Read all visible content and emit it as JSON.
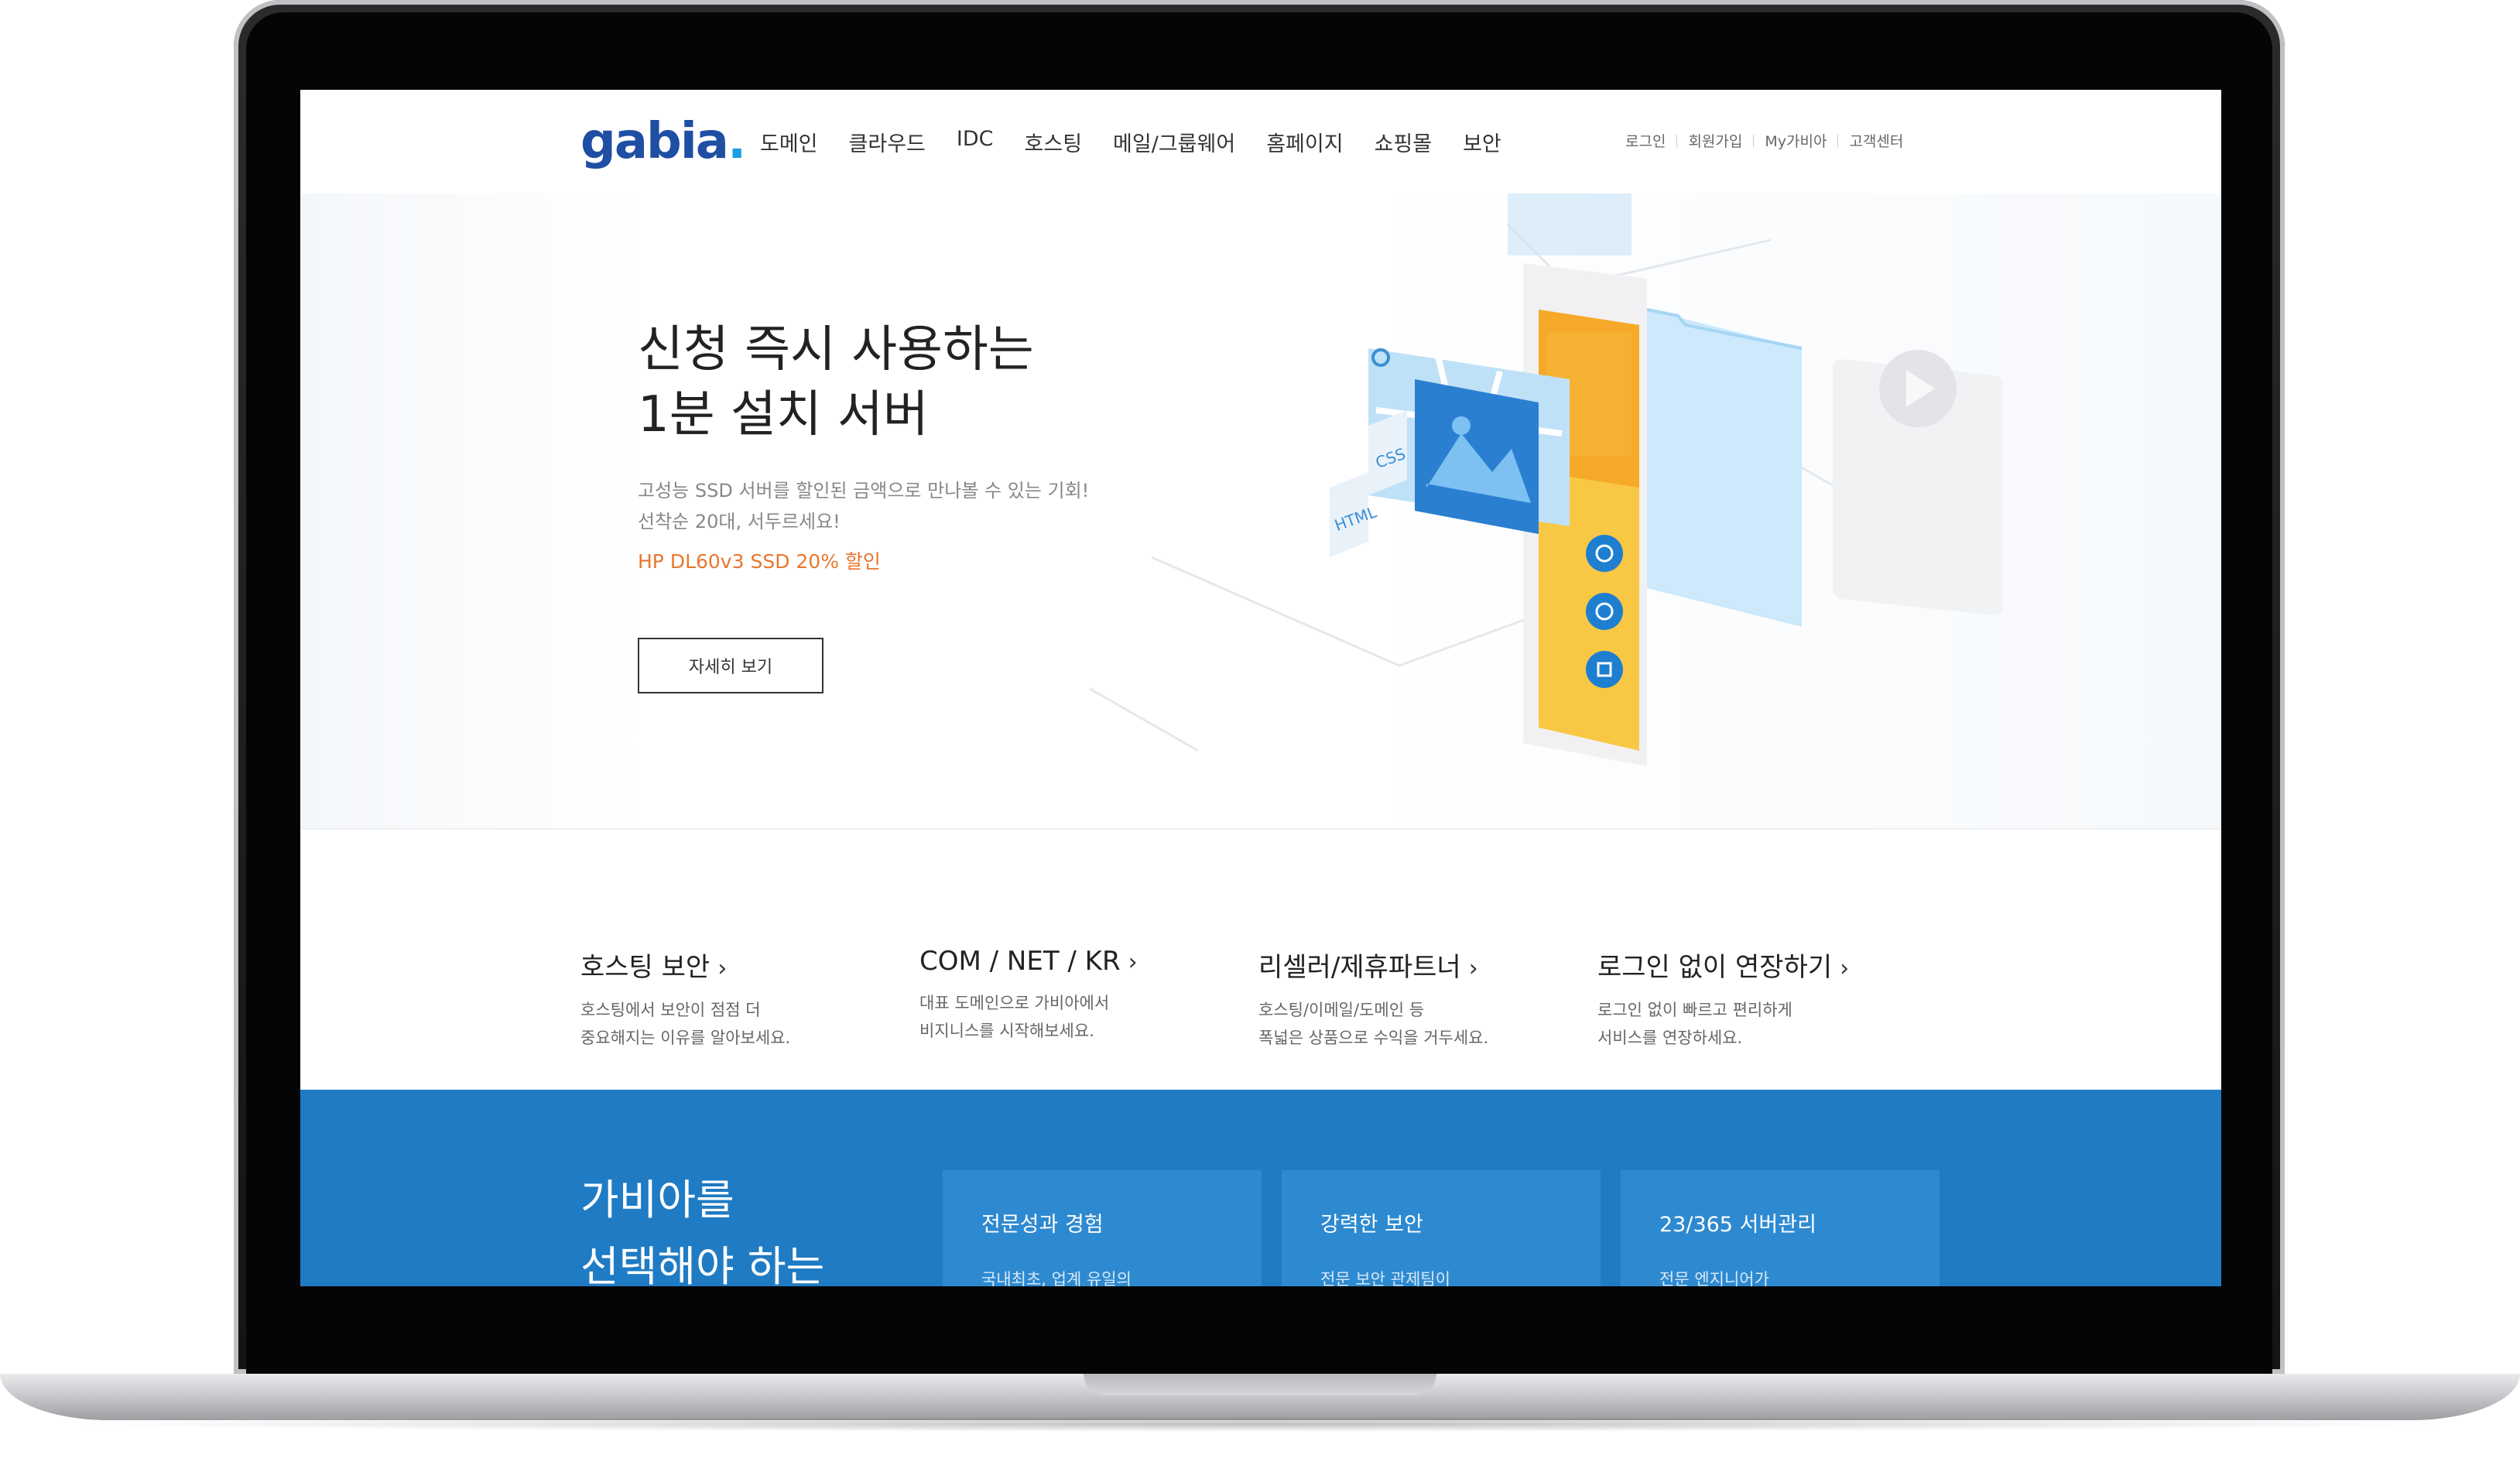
{
  "header": {
    "logo_text": "gabia",
    "logo_dot": ".",
    "nav": [
      "도메인",
      "클라우드",
      "IDC",
      "호스팅",
      "메일/그룹웨어",
      "홈페이지",
      "쇼핑몰",
      "보안"
    ],
    "util": [
      "로그인",
      "회원가입",
      "My가비아",
      "고객센터"
    ]
  },
  "hero": {
    "title": "신청 즉시 사용하는\n1분 설치 서버",
    "desc": "고성능 SSD 서버를 할인된 금액으로 만나볼 수 있는 기회!\n선착순 20대, 서두르세요!",
    "promo": "HP DL60v3 SSD 20% 할인",
    "button": "자세히 보기",
    "art_labels": {
      "html": "HTML",
      "css": "CSS"
    }
  },
  "quick_links": [
    {
      "title": "호스팅 보안",
      "arrow": "›",
      "desc": "호스팅에서 보안이 점점 더\n중요해지는 이유를 알아보세요."
    },
    {
      "title": "COM / NET / KR",
      "arrow": "›",
      "desc": "대표 도메인으로 가비아에서\n비지니스를 시작해보세요."
    },
    {
      "title": "리셀러/제휴파트너",
      "arrow": "›",
      "desc": "호스팅/이메일/도메인 등\n폭넓은 상품으로 수익을 거두세요."
    },
    {
      "title": "로그인 없이 연장하기",
      "arrow": "›",
      "desc": "로그인 없이 빠르고 편리하게\n서비스를 연장하세요."
    }
  ],
  "band": {
    "title": "가비아를\n선택해야 하는",
    "cards": [
      {
        "title": "전문성과 경험",
        "desc": "국내최초, 업계 유일의"
      },
      {
        "title": "강력한 보안",
        "desc": "전문 보안 관제팀이"
      },
      {
        "title": "23/365 서버관리",
        "desc": "전문 엔지니어가"
      }
    ]
  },
  "colors": {
    "brand_blue": "#1f4fa3",
    "band_blue": "#1f7bc4",
    "promo_orange": "#e8762d"
  }
}
